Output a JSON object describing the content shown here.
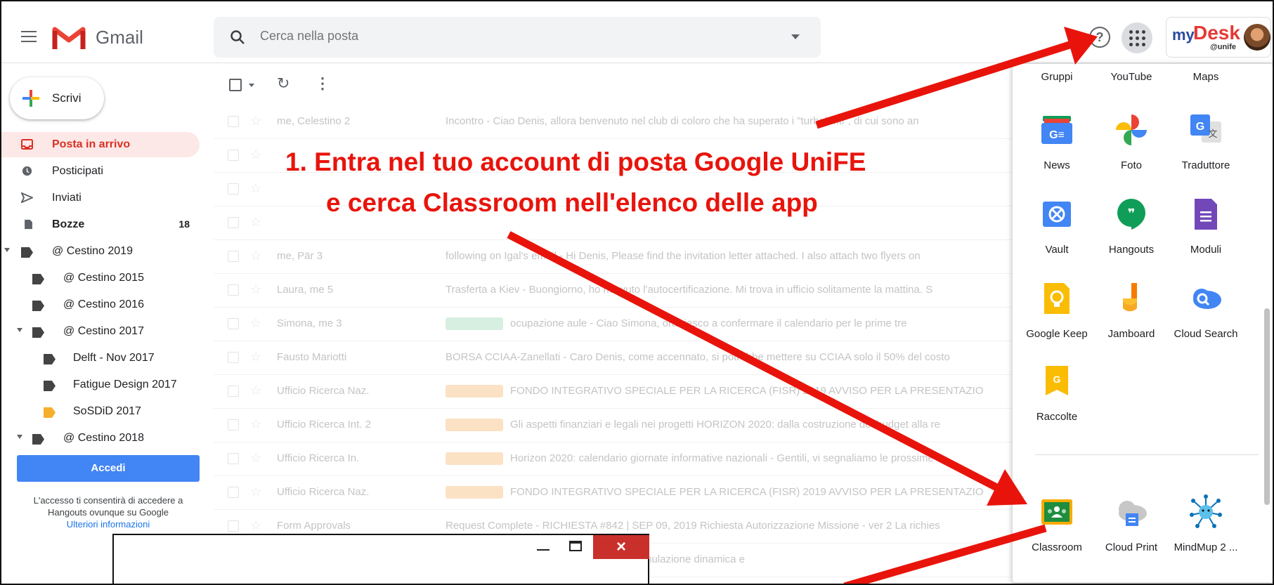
{
  "header": {
    "app_name": "Gmail",
    "search_placeholder": "Cerca nella posta",
    "help_glyph": "?",
    "mydesk_my": "my",
    "mydesk_desk": "Desk",
    "mydesk_unife": "@unife"
  },
  "sidebar": {
    "compose_label": "Scrivi",
    "items": [
      {
        "label": "Posta in arrivo",
        "icon": "inbox-icon",
        "active": true
      },
      {
        "label": "Posticipati",
        "icon": "clock-icon"
      },
      {
        "label": "Inviati",
        "icon": "send-icon"
      },
      {
        "label": "Bozze",
        "icon": "draft-icon",
        "count": "18"
      },
      {
        "label": "@ Cestino 2019",
        "icon": "label-icon"
      },
      {
        "label": "@ Cestino 2015",
        "icon": "label-icon"
      },
      {
        "label": "@ Cestino 2016",
        "icon": "label-icon"
      },
      {
        "label": "@ Cestino 2017",
        "icon": "label-icon"
      },
      {
        "label": "Delft - Nov 2017",
        "icon": "label-icon"
      },
      {
        "label": "Fatigue Design 2017",
        "icon": "label-icon"
      },
      {
        "label": "SoSDiD 2017",
        "icon": "label-icon",
        "color": "#f6ae2d"
      },
      {
        "label": "@ Cestino 2018",
        "icon": "label-icon"
      }
    ],
    "hangouts": {
      "button": "Accedi",
      "text1": "L'accesso ti consentirà di accedere a",
      "text2": "Hangouts ovunque su Google",
      "link": "Ulteriori informazioni"
    }
  },
  "emails": [
    {
      "sender": "me, Celestino 2",
      "subject": "Incontro - Ciao Denis, allora benvenuto nel club di coloro che ha superato i \"turbolenti\", di cui sono an"
    },
    {
      "sender": "",
      "subject": ""
    },
    {
      "sender": "",
      "subject": ""
    },
    {
      "sender": "",
      "subject": ""
    },
    {
      "sender": "me, Pär 3",
      "subject": "following on Igal's email - Hi Denis, Please find the invitation letter attached. I also attach two flyers on"
    },
    {
      "sender": "Laura, me 5",
      "subject": "Trasferta a Kiev - Buongiorno, ho ricevuto l'autocertificazione. Mi trova in ufficio solitamente la mattina. S"
    },
    {
      "sender": "Simona, me 3",
      "subject": "ocupazione aule - Ciao Simona, ora riesco a confermare il calendario per le prime tre",
      "badge": "green"
    },
    {
      "sender": "Fausto Mariotti",
      "subject": "BORSA CCIAA-Zanellati - Caro Denis, come accennato, si potrebbe mettere su CCIAA solo il 50% del costo"
    },
    {
      "sender": "Ufficio Ricerca Naz.",
      "subject": "FONDO INTEGRATIVO SPECIALE PER LA RICERCA (FISR) 2019 AVVISO PER LA PRESENTAZIO",
      "badge": "orange"
    },
    {
      "sender": "Ufficio Ricerca Int. 2",
      "subject": "Gli aspetti finanziari e legali nei progetti HORIZON 2020: dalla costruzione del budget alla re",
      "badge": "orange"
    },
    {
      "sender": "Ufficio Ricerca In.",
      "subject": "Horizon 2020: calendario giornate informative nazionali - Gentili, vi segnaliamo le prossime",
      "badge": "orange"
    },
    {
      "sender": "Ufficio Ricerca Naz.",
      "subject": "FONDO INTEGRATIVO SPECIALE PER LA RICERCA (FISR) 2019 AVVISO PER LA PRESENTAZIO",
      "badge": "orange"
    },
    {
      "sender": "Form Approvals",
      "subject": "Request Complete - RICHIESTA #842 | SEP 09, 2019 Richiesta Autorizzazione Missione - ver 2 La richies"
    },
    {
      "sender": "",
      "subject": "collega, ti confermo i nostri incontri sulla simulazione dinamica e"
    }
  ],
  "apps_panel": {
    "top_row": [
      "Gruppi",
      "YouTube",
      "Maps"
    ],
    "apps": [
      {
        "label": "News",
        "icon": "news-icon"
      },
      {
        "label": "Foto",
        "icon": "photos-icon"
      },
      {
        "label": "Traduttore",
        "icon": "translate-icon"
      },
      {
        "label": "Vault",
        "icon": "vault-icon"
      },
      {
        "label": "Hangouts",
        "icon": "hangouts-icon"
      },
      {
        "label": "Moduli",
        "icon": "forms-icon"
      },
      {
        "label": "Google Keep",
        "icon": "keep-icon"
      },
      {
        "label": "Jamboard",
        "icon": "jamboard-icon"
      },
      {
        "label": "Cloud Search",
        "icon": "cloud-search-icon"
      },
      {
        "label": "Raccolte",
        "icon": "collections-icon"
      }
    ],
    "more_apps": [
      {
        "label": "Classroom",
        "icon": "classroom-icon"
      },
      {
        "label": "Cloud Print",
        "icon": "cloud-print-icon"
      },
      {
        "label": "MindMup 2 ...",
        "icon": "mindmup-icon"
      }
    ]
  },
  "annotation": {
    "line1": "1. Entra nel tuo account di posta Google UniFE",
    "line2": "e cerca Classroom nell'elenco delle app",
    "color": "#e8140c"
  },
  "popup": {
    "close_glyph": "×"
  }
}
